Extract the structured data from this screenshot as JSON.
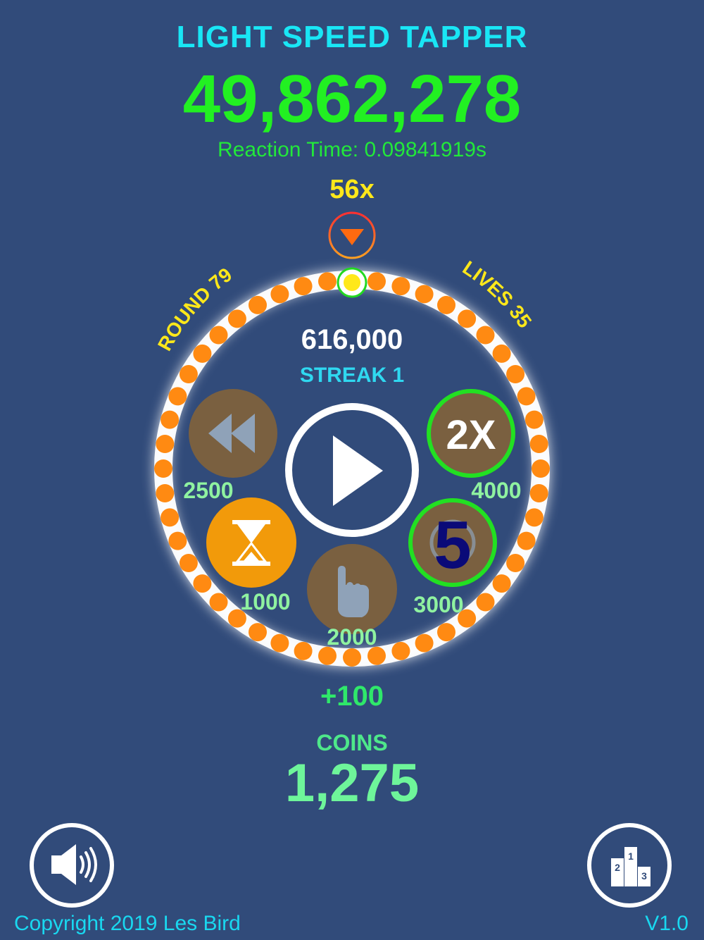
{
  "header": {
    "title": "LIGHT SPEED TAPPER",
    "score": "49,862,278",
    "reaction_time": "Reaction Time: 0.09841919s",
    "multiplier": "56x"
  },
  "ring": {
    "round_label": "ROUND 79",
    "lives_label": "LIVES 35",
    "round_score": "616,000",
    "streak": "STREAK 1"
  },
  "powerups": {
    "rewind": {
      "icon": "rewind-icon",
      "cost": "2500"
    },
    "double": {
      "label": "2X",
      "cost": "4000"
    },
    "hourglass": {
      "icon": "hourglass-icon",
      "cost": "1000"
    },
    "tap": {
      "icon": "tap-finger-icon",
      "cost": "2000"
    },
    "countdown": {
      "label": "5",
      "cost": "3000"
    }
  },
  "center": {
    "icon": "play-icon"
  },
  "bonus": "+100",
  "coins": {
    "label": "COINS",
    "value": "1,275"
  },
  "footer": {
    "copyright": "Copyright 2019 Les Bird",
    "version": "V1.0",
    "sound_icon": "speaker-icon",
    "leaderboard_icon": "podium-icon"
  },
  "colors": {
    "background": "#314b7a",
    "title": "#19e6f5",
    "score": "#22f022",
    "dot": "#ff8a12",
    "highlight_dot": "#ffe81a",
    "powerup_brown": "#7a6040",
    "powerup_orange": "#f29a0a",
    "active_ring": "#22e022"
  }
}
